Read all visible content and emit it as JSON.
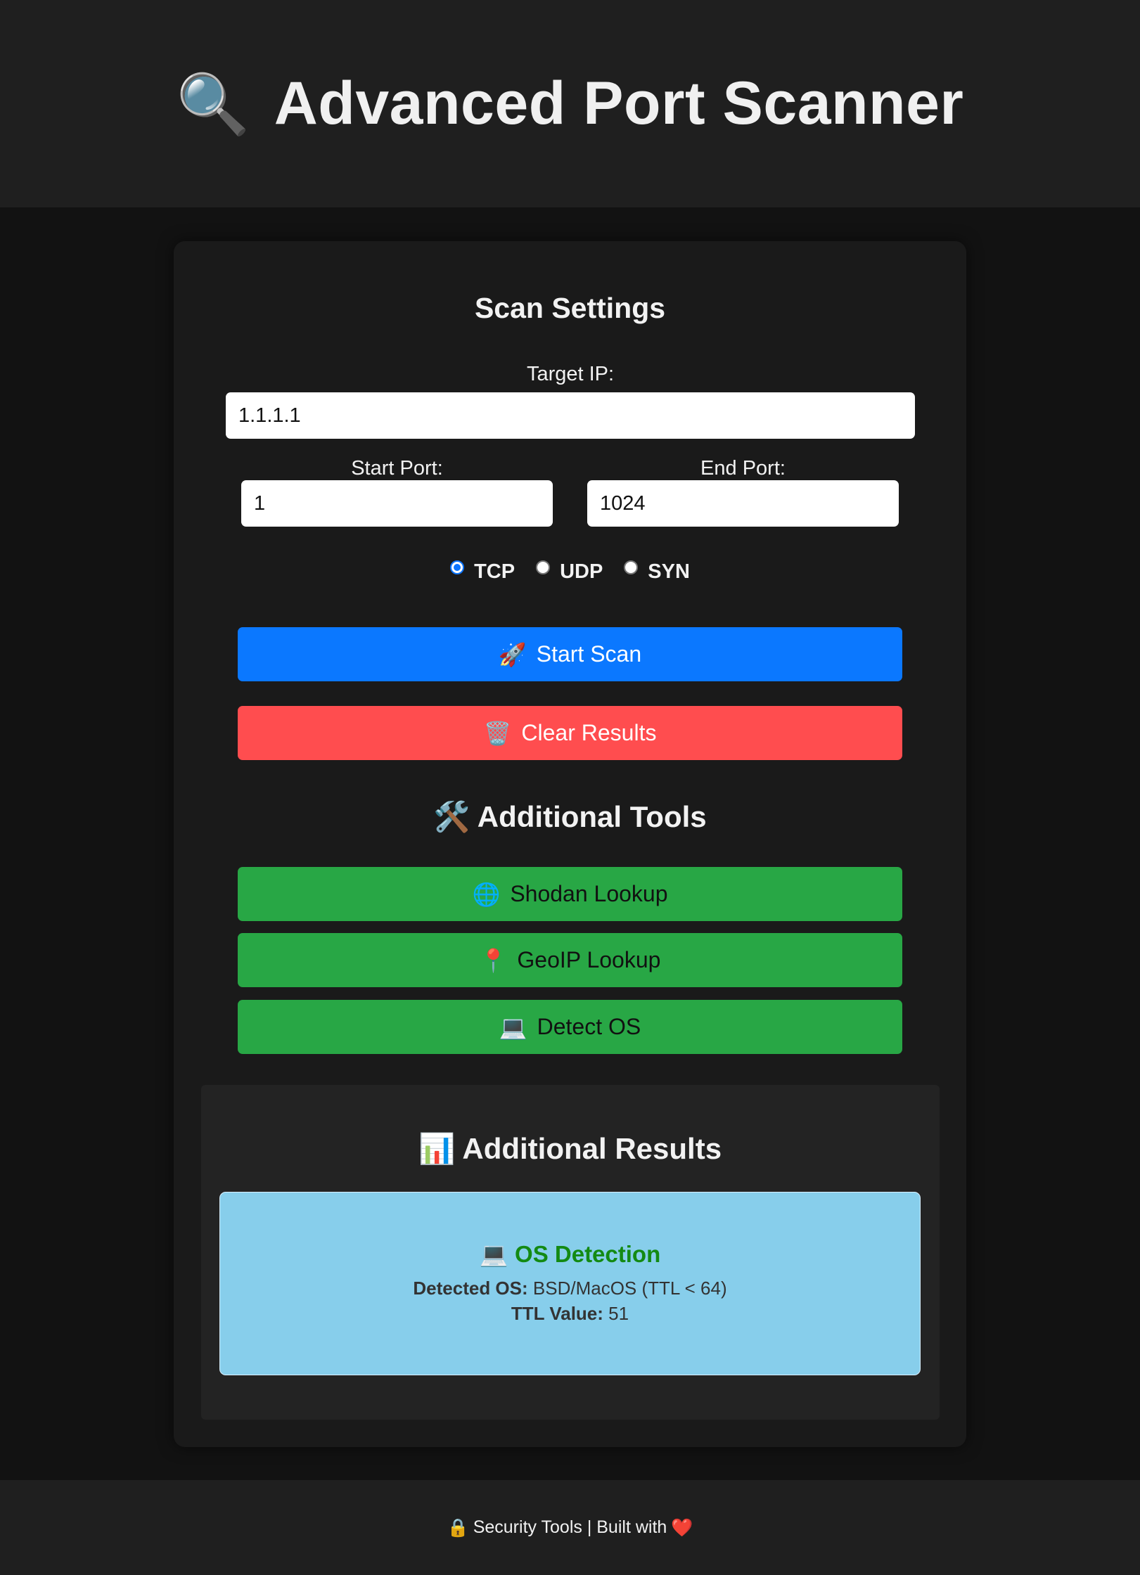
{
  "header": {
    "icon": "🔍",
    "icon_name": "magnifying-glass-icon",
    "title": "Advanced Port Scanner"
  },
  "scan_settings": {
    "title": "Scan Settings",
    "target_ip_label": "Target IP:",
    "target_ip_value": "1.1.1.1",
    "start_port_label": "Start Port:",
    "start_port_value": "1",
    "end_port_label": "End Port:",
    "end_port_value": "1024",
    "protocols": [
      {
        "label": "TCP",
        "checked": true
      },
      {
        "label": "UDP",
        "checked": false
      },
      {
        "label": "SYN",
        "checked": false
      }
    ],
    "start_button": {
      "icon": "🚀",
      "icon_name": "rocket-icon",
      "label": "Start Scan",
      "color": "#0b78ff"
    },
    "clear_button": {
      "icon": "🗑️",
      "icon_name": "trash-icon",
      "label": "Clear Results",
      "color": "#ff4d4f"
    }
  },
  "tools": {
    "icon": "🛠️",
    "icon_name": "tools-icon",
    "title": "Additional Tools",
    "buttons": [
      {
        "icon": "🌐",
        "icon_name": "globe-icon",
        "label": "Shodan Lookup"
      },
      {
        "icon": "📍",
        "icon_name": "pin-icon",
        "label": "GeoIP Lookup"
      },
      {
        "icon": "💻",
        "icon_name": "laptop-icon",
        "label": "Detect OS"
      }
    ],
    "button_color": "#28a745"
  },
  "results": {
    "icon": "📊",
    "icon_name": "bar-chart-icon",
    "title": "Additional Results",
    "os_detection": {
      "icon": "💻",
      "icon_name": "laptop-icon",
      "title": "OS Detection",
      "detected_label": "Detected OS:",
      "detected_value": "BSD/MacOS (TTL < 64)",
      "ttl_label": "TTL Value:",
      "ttl_value": "51",
      "background": "#87ceeb",
      "title_color": "#138a13"
    }
  },
  "footer": {
    "lock_icon": "🔒",
    "lock_icon_name": "lock-icon",
    "text": "Security Tools | Built with",
    "heart_icon": "❤️",
    "heart_icon_name": "heart-icon"
  }
}
